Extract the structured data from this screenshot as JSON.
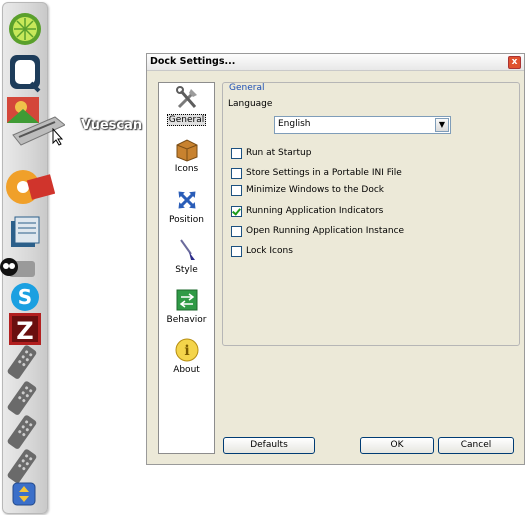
{
  "dock": {
    "items": [
      {
        "name": "lime"
      },
      {
        "name": "qt"
      },
      {
        "name": "vuescan"
      },
      {
        "name": "media-player"
      },
      {
        "name": "document"
      },
      {
        "name": "webcam"
      },
      {
        "name": "skype"
      },
      {
        "name": "filezilla"
      },
      {
        "name": "remote-1"
      },
      {
        "name": "remote-2"
      },
      {
        "name": "remote-3"
      },
      {
        "name": "remote-4"
      },
      {
        "name": "dock-menu"
      }
    ],
    "hover_label": "Vuescan"
  },
  "dialog": {
    "title": "Dock Settings...",
    "close_label": "x",
    "sidebar": [
      {
        "label": "General",
        "icon": "tools-icon"
      },
      {
        "label": "Icons",
        "icon": "box-icon"
      },
      {
        "label": "Position",
        "icon": "move-icon"
      },
      {
        "label": "Style",
        "icon": "brush-icon"
      },
      {
        "label": "Behavior",
        "icon": "behavior-icon"
      },
      {
        "label": "About",
        "icon": "info-icon"
      }
    ],
    "active_tab": "General",
    "group_title": "General",
    "language": {
      "label": "Language",
      "value": "English"
    },
    "options": [
      {
        "label": "Run at Startup",
        "checked": false
      },
      {
        "label": "Store Settings in a Portable INI File",
        "checked": false
      },
      {
        "label": "Minimize Windows to the Dock",
        "checked": false
      },
      {
        "label": "Running Application Indicators",
        "checked": true
      },
      {
        "label": "Open Running Application Instance",
        "checked": false
      },
      {
        "label": "Lock Icons",
        "checked": false
      }
    ],
    "buttons": {
      "defaults": "Defaults",
      "ok": "OK",
      "cancel": "Cancel"
    }
  }
}
